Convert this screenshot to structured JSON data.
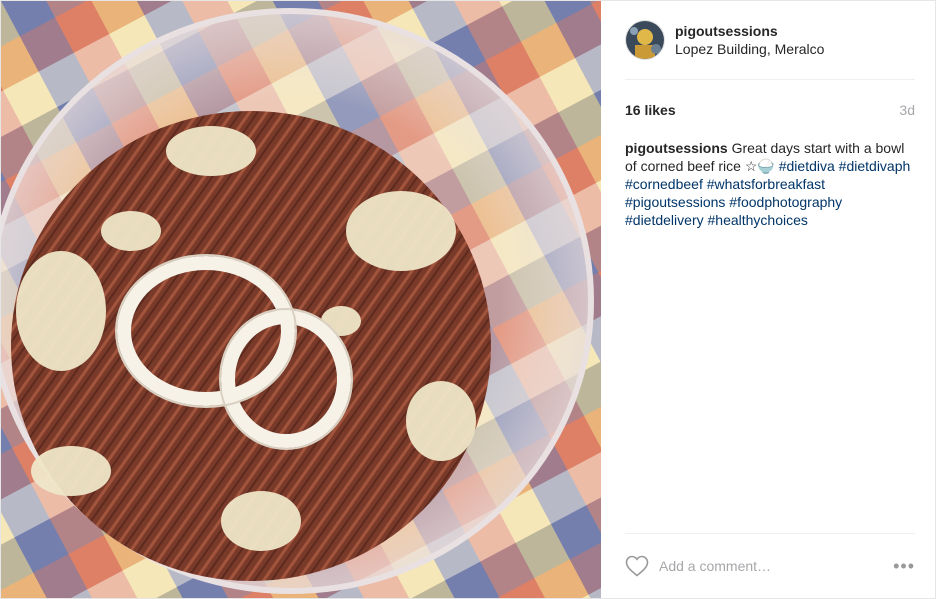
{
  "post": {
    "header": {
      "username": "pigoutsessions",
      "location": "Lopez Building, Meralco"
    },
    "stats": {
      "likes": "16 likes",
      "time": "3d"
    },
    "caption": {
      "username": "pigoutsessions",
      "text": "Great days start with a bowl of corned beef rice ☆🍚",
      "hashtags": [
        "#dietdiva",
        "#dietdivaph",
        "#cornedbeef",
        "#whatsforbreakfast",
        "#pigoutsessions",
        "#foodphotography",
        "#dietdelivery",
        "#healthychoices"
      ]
    },
    "footer": {
      "comment_placeholder": "Add a comment…",
      "more_label": "•••",
      "like_icon": "heart-icon"
    },
    "photo": {
      "description_colors": {
        "tablecloth_blue": "#5a6aa8",
        "tablecloth_red": "#d8614a",
        "tablecloth_yellow": "#f2d86b",
        "beef": "#7a3a2a",
        "rice": "#efe6c8",
        "onion": "#f6f2e8"
      }
    }
  }
}
